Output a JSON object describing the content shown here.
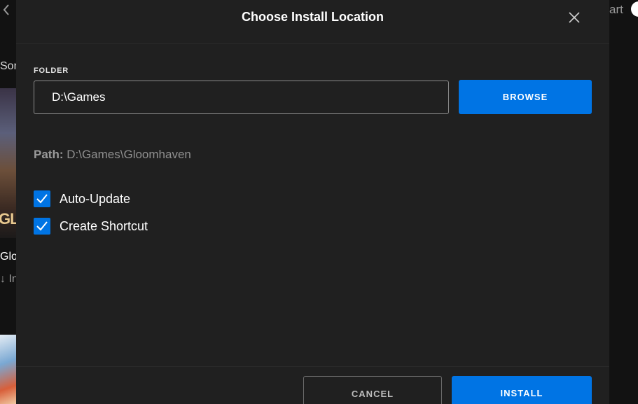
{
  "background": {
    "back_icon": "chevron-left-icon",
    "sort_text": "Sort",
    "thumb_text": "GL",
    "game_title_partial": "Gloo",
    "game_sub_partial": "↓ In",
    "cart_text": "art"
  },
  "modal": {
    "title": "Choose Install Location",
    "close_icon": "close-icon",
    "folder_label": "FOLDER",
    "folder_value": "D:\\Games",
    "browse_label": "BROWSE",
    "path_label": "Path:",
    "path_value": "D:\\Games\\Gloomhaven",
    "options": [
      {
        "label": "Auto-Update",
        "checked": true
      },
      {
        "label": "Create Shortcut",
        "checked": true
      }
    ],
    "cancel_label": "CANCEL",
    "install_label": "INSTALL"
  },
  "colors": {
    "accent": "#0074e4",
    "modal_bg": "#202020",
    "page_bg": "#121212"
  }
}
